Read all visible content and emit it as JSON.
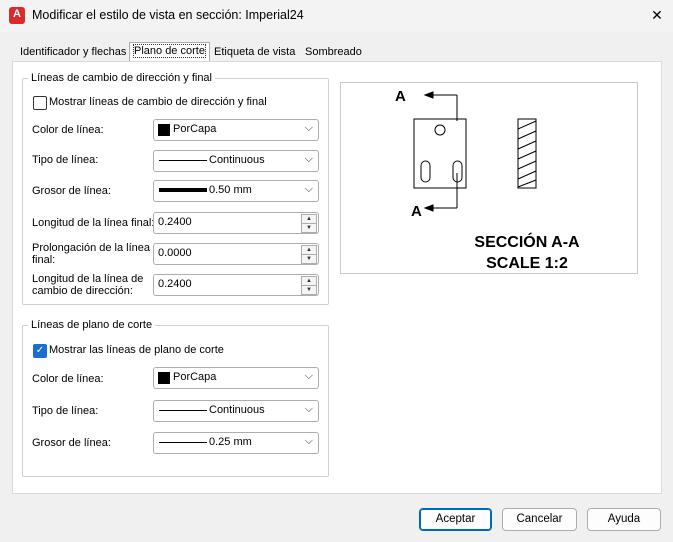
{
  "window": {
    "title": "Modificar el estilo de vista en sección: Imperial24",
    "app_icon_letter": "A"
  },
  "tabs": [
    {
      "label": "Identificador y flechas",
      "active": false
    },
    {
      "label": "Plano de corte",
      "active": true
    },
    {
      "label": "Etiqueta de vista",
      "active": false
    },
    {
      "label": "Sombreado",
      "active": false
    }
  ],
  "group1": {
    "legend": "Líneas de cambio de dirección y final",
    "show_checkbox": {
      "label": "Mostrar líneas de cambio de dirección y final",
      "checked": false
    },
    "line_color": {
      "label": "Color de línea:",
      "value": "PorCapa"
    },
    "line_type": {
      "label": "Tipo de línea:",
      "value": "Continuous"
    },
    "line_weight": {
      "label": "Grosor de línea:",
      "value": "0.50 mm"
    },
    "end_length": {
      "label": "Longitud de la línea final:",
      "value": "0.2400"
    },
    "extension": {
      "label_line1": "Prolongación de la línea",
      "label_line2": "final:",
      "value": "0.0000"
    },
    "jog_length": {
      "label_line1": "Longitud de la línea de",
      "label_line2": "cambio de dirección:",
      "value": "0.2400"
    }
  },
  "group2": {
    "legend": "Líneas de plano de corte",
    "show_checkbox": {
      "label": "Mostrar las líneas de plano de corte",
      "checked": true
    },
    "line_color": {
      "label": "Color de línea:",
      "value": "PorCapa"
    },
    "line_type": {
      "label": "Tipo de línea:",
      "value": "Continuous"
    },
    "line_weight": {
      "label": "Grosor de línea:",
      "value": "0.25 mm"
    }
  },
  "preview": {
    "label_a_top": "A",
    "label_a_bottom": "A",
    "caption_line1": "SECCIÓN A-A",
    "caption_line2": "SCALE 1:2"
  },
  "buttons": {
    "accept": "Aceptar",
    "cancel": "Cancelar",
    "help": "Ayuda"
  },
  "colors": {
    "accent": "#0067c0",
    "app_icon": "#d92b2b",
    "checkbox_checked": "#1a6fd0"
  }
}
